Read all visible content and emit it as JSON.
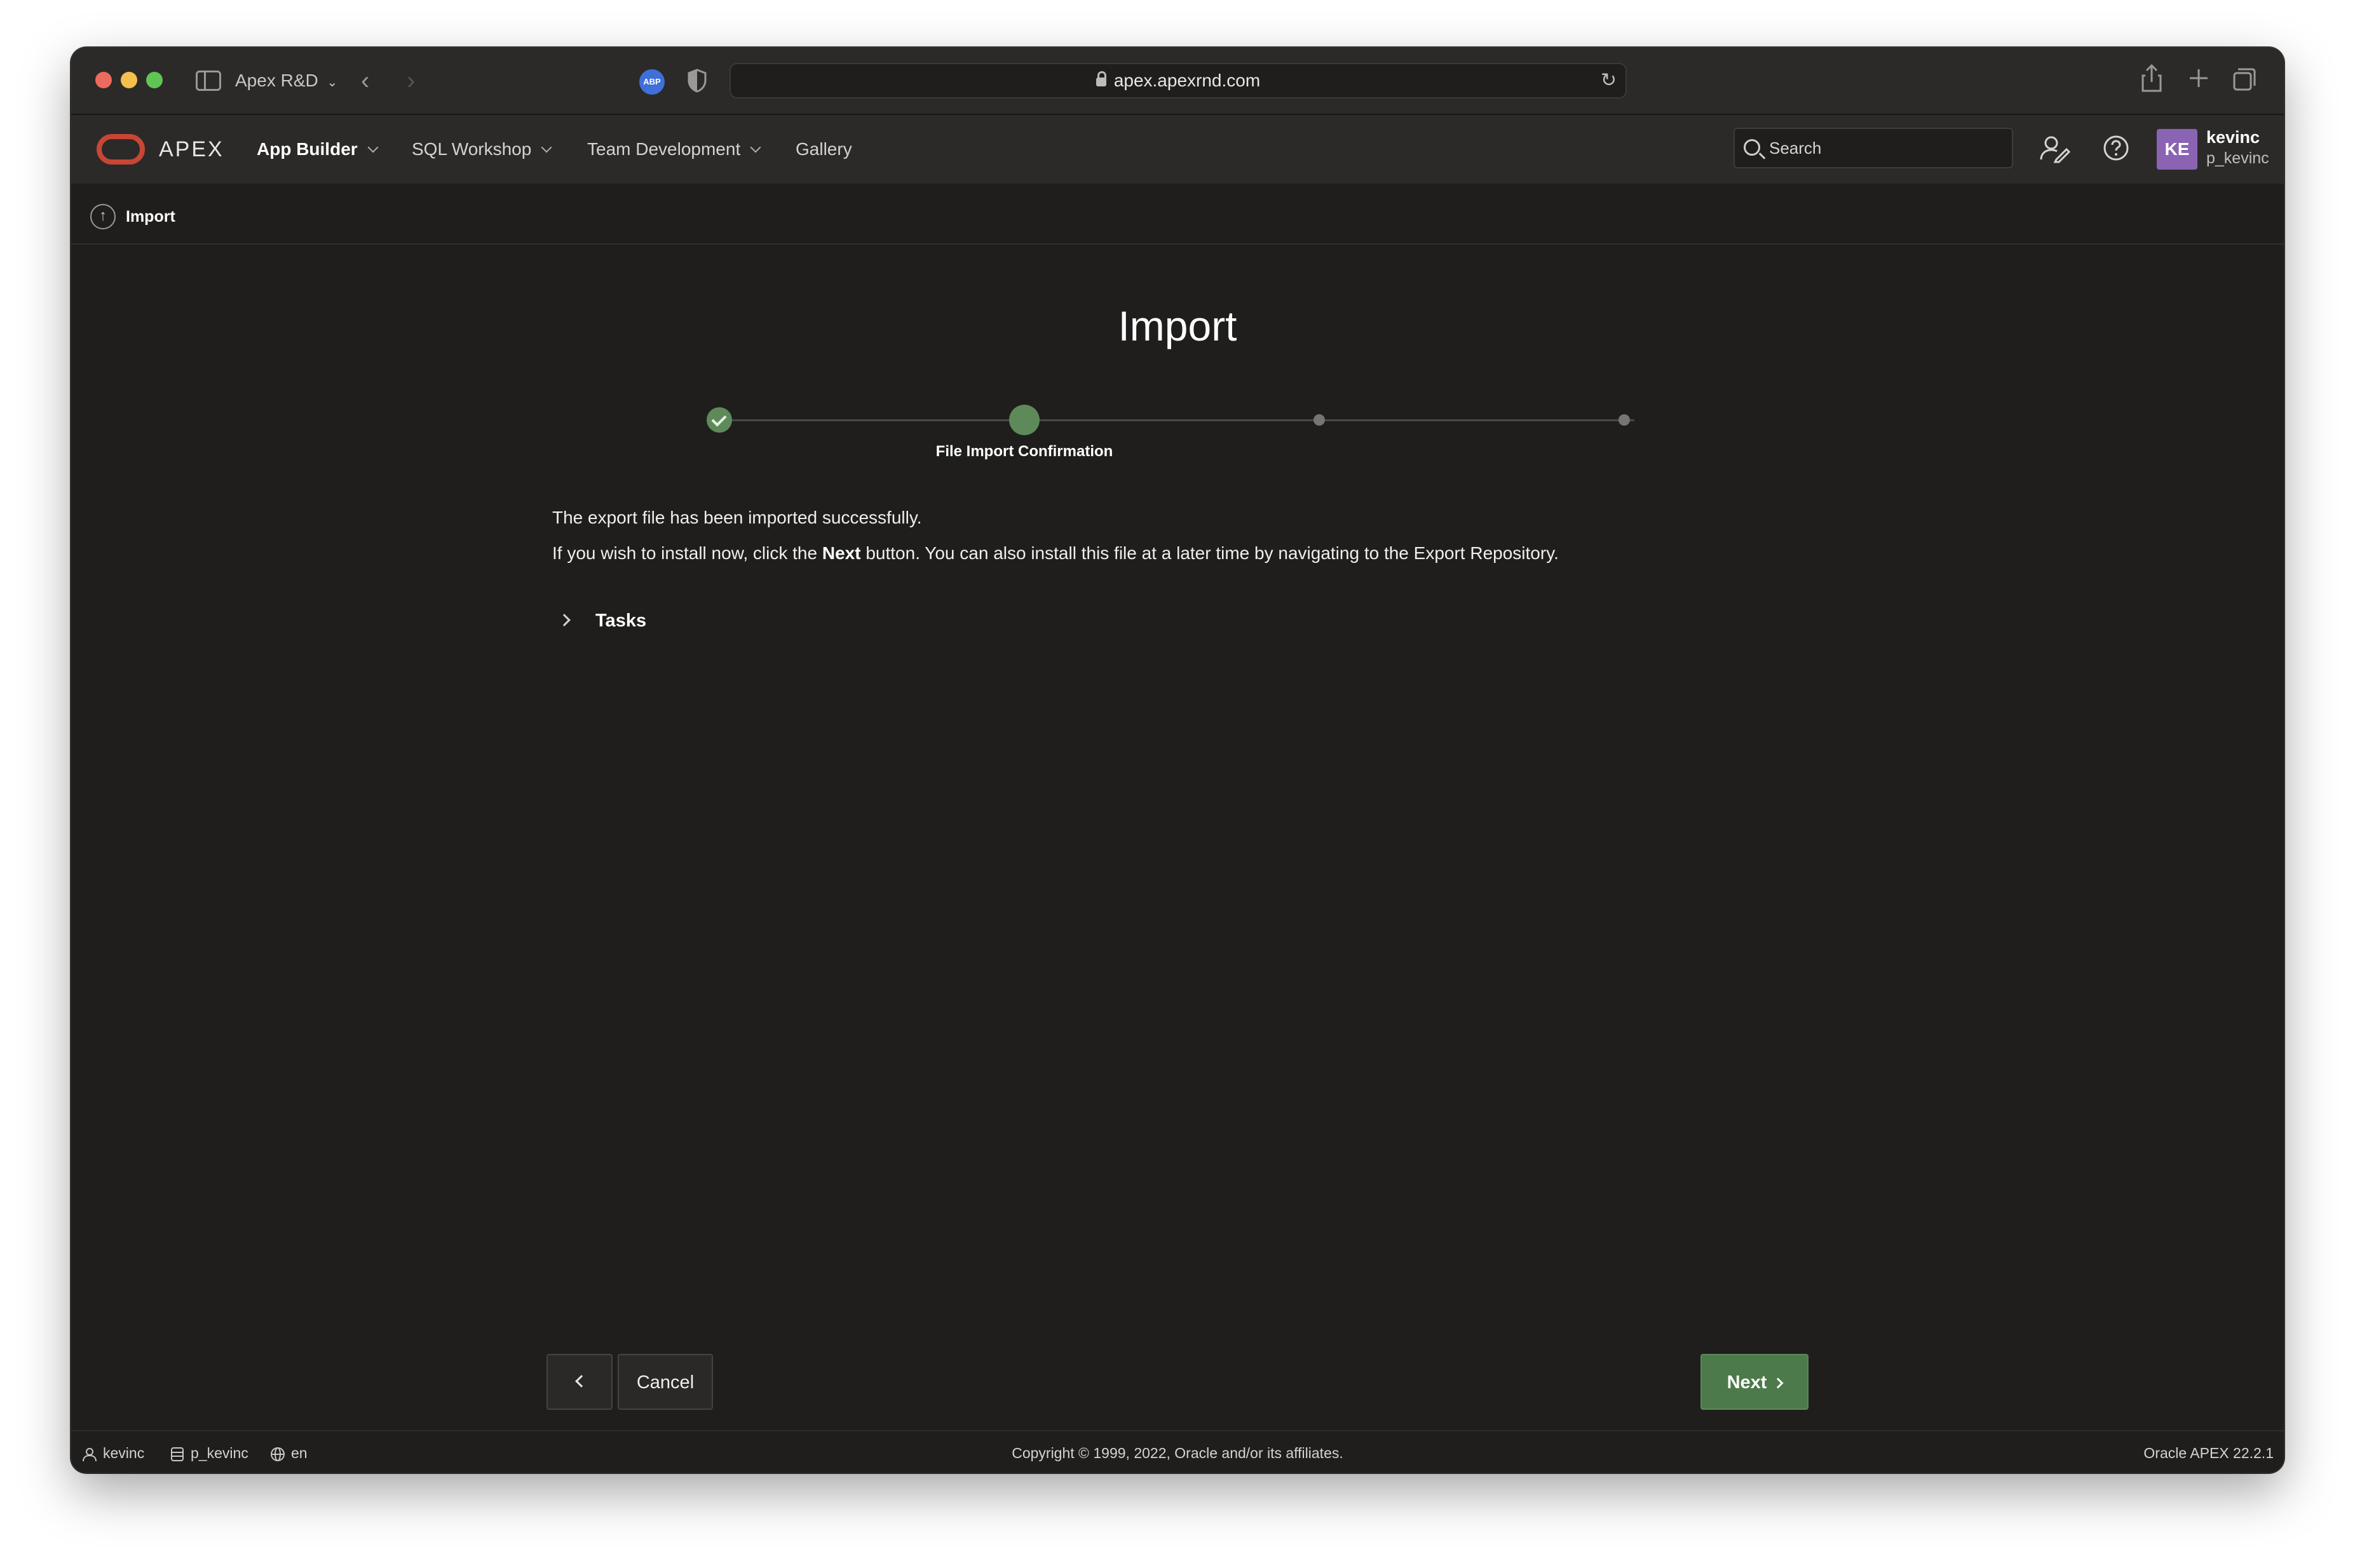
{
  "browser": {
    "tab_group": "Apex R&D",
    "url": "apex.apexrnd.com",
    "abp_label": "ABP"
  },
  "nav": {
    "brand": "APEX",
    "menu": [
      {
        "label": "App Builder",
        "has_dropdown": true,
        "active": true
      },
      {
        "label": "SQL Workshop",
        "has_dropdown": true
      },
      {
        "label": "Team Development",
        "has_dropdown": true
      },
      {
        "label": "Gallery",
        "has_dropdown": false
      }
    ],
    "search_placeholder": "Search",
    "user": {
      "initials": "KE",
      "name": "kevinc",
      "workspace": "p_kevinc"
    }
  },
  "breadcrumb": {
    "label": "Import"
  },
  "main": {
    "title": "Import",
    "wizard": {
      "current_step_label": "File Import Confirmation",
      "total_steps": 4,
      "current_step": 2
    },
    "message_line1": "The export file has been imported successfully.",
    "message_line2_pre": "If you wish to install now, click the ",
    "message_line2_bold": "Next",
    "message_line2_post": " button. You can also install this file at a later time by navigating to the Export Repository.",
    "tasks_label": "Tasks"
  },
  "buttons": {
    "cancel": "Cancel",
    "next": "Next"
  },
  "footer": {
    "user": "kevinc",
    "workspace": "p_kevinc",
    "language": "en",
    "copyright": "Copyright © 1999, 2022, Oracle and/or its affiliates.",
    "version": "Oracle APEX 22.2.1"
  },
  "colors": {
    "accent_green": "#5e8a5a",
    "brand_red": "#c74634",
    "avatar": "#8a63b3"
  }
}
